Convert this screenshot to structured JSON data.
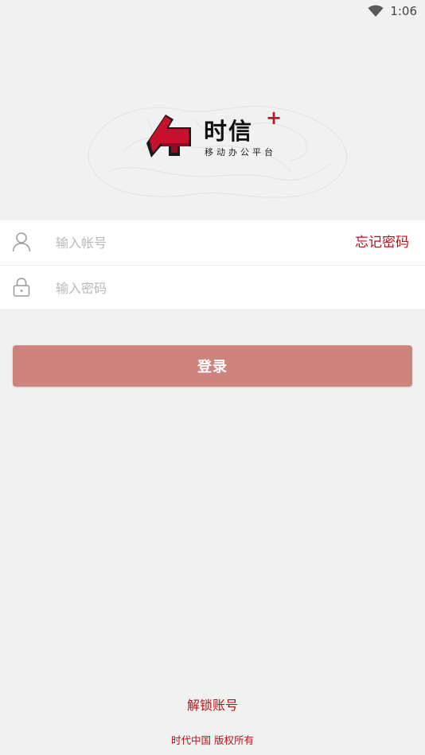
{
  "status_bar": {
    "time": "1:06",
    "wifi_icon": "wifi-icon"
  },
  "logo": {
    "title": "时信",
    "plus": "+",
    "subtitle": "移动办公平台",
    "mark_icon": "logo-mark-icon",
    "brand_color": "#c8102e"
  },
  "form": {
    "username": {
      "placeholder": "输入帐号",
      "value": "",
      "icon": "user-icon"
    },
    "password": {
      "placeholder": "输入密码",
      "value": "",
      "icon": "lock-icon"
    },
    "forgot_label": "忘记密码"
  },
  "login_button": {
    "label": "登录",
    "color": "#cf837f"
  },
  "footer": {
    "unlock_label": "解锁账号",
    "copyright": "时代中国 版权所有",
    "accent_color": "#b3131c"
  }
}
